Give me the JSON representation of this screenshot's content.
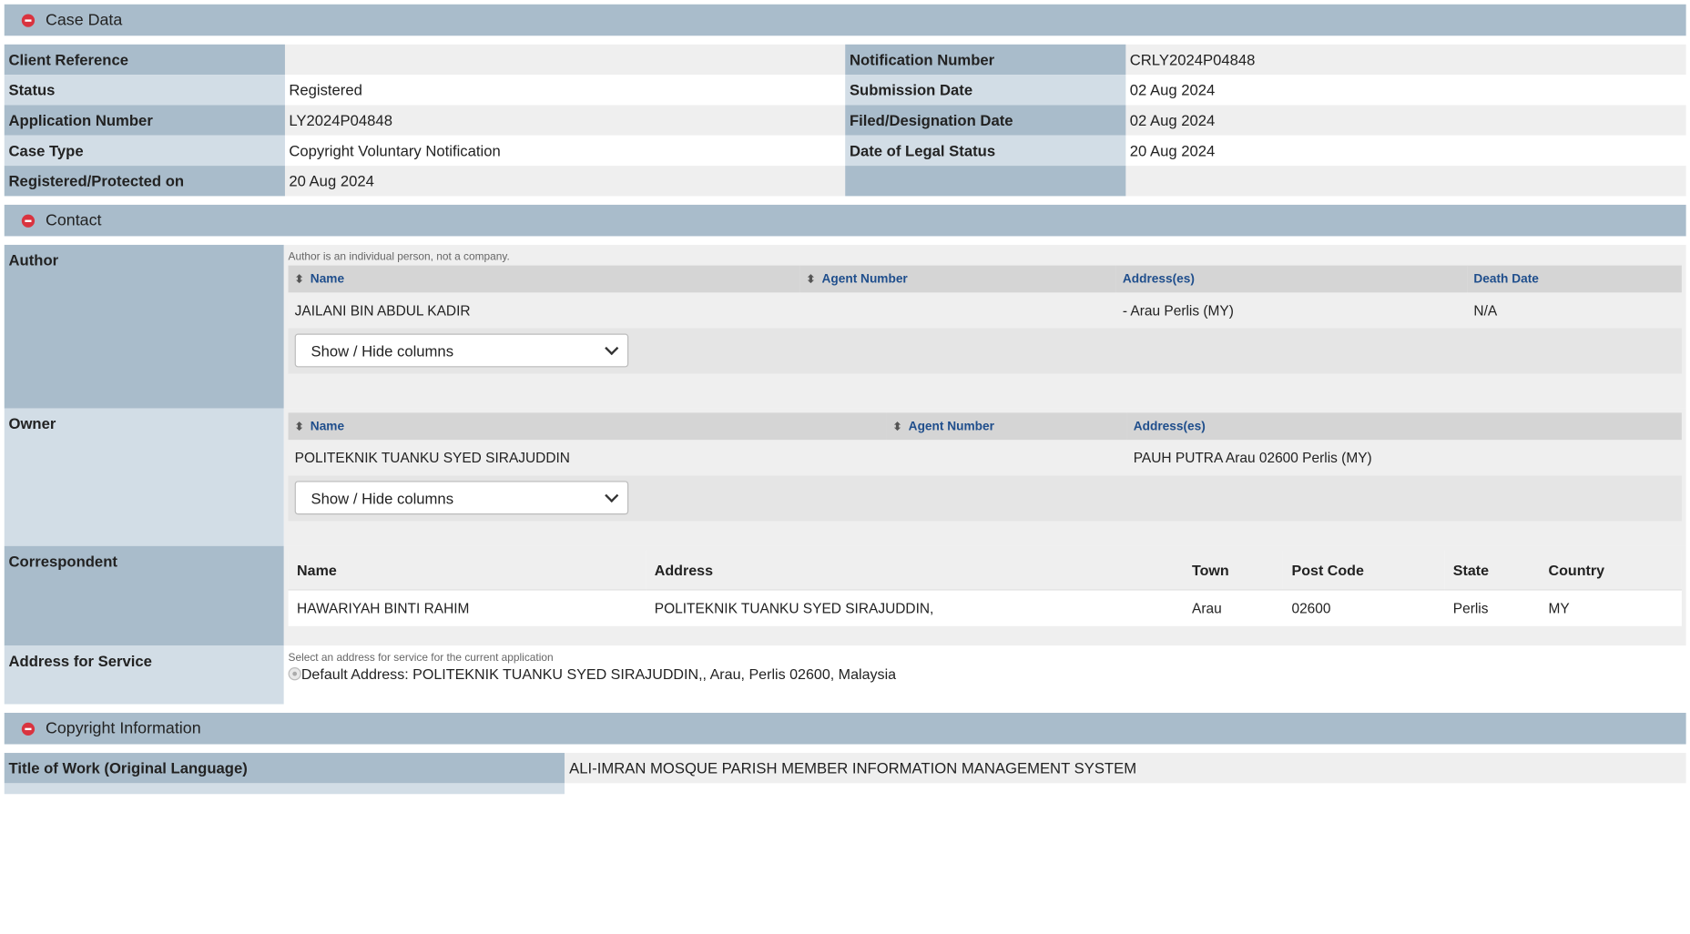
{
  "case_data": {
    "header": "Case Data",
    "rows": [
      {
        "l1": "Client Reference",
        "v1": "",
        "l2": "Notification Number",
        "v2": "CRLY2024P04848"
      },
      {
        "l1": "Status",
        "v1": "Registered",
        "l2": "Submission Date",
        "v2": "02 Aug 2024"
      },
      {
        "l1": "Application Number",
        "v1": "LY2024P04848",
        "l2": "Filed/Designation Date",
        "v2": "02 Aug 2024"
      },
      {
        "l1": "Case Type",
        "v1": "Copyright Voluntary Notification",
        "l2": "Date of Legal Status",
        "v2": "20 Aug 2024"
      },
      {
        "l1": "Registered/Protected on",
        "v1": "20 Aug 2024",
        "l2": "",
        "v2": ""
      }
    ]
  },
  "contact": {
    "header": "Contact",
    "author": {
      "label": "Author",
      "note": "Author is an individual person, not a company.",
      "columns": [
        "Name",
        "Agent Number",
        "Address(es)",
        "Death Date"
      ],
      "row": {
        "name": "JAILANI BIN ABDUL KADIR",
        "agent": "",
        "address": "- Arau Perlis (MY)",
        "death": "N/A"
      },
      "select_label": "Show / Hide columns"
    },
    "owner": {
      "label": "Owner",
      "columns": [
        "Name",
        "Agent Number",
        "Address(es)"
      ],
      "row": {
        "name": "POLITEKNIK TUANKU SYED SIRAJUDDIN",
        "agent": "",
        "address": "PAUH PUTRA Arau 02600 Perlis (MY)"
      },
      "select_label": "Show / Hide columns"
    },
    "correspondent": {
      "label": "Correspondent",
      "columns": [
        "Name",
        "Address",
        "Town",
        "Post Code",
        "State",
        "Country"
      ],
      "row": {
        "name": "HAWARIYAH BINTI RAHIM",
        "address": "POLITEKNIK TUANKU SYED SIRAJUDDIN,",
        "town": "Arau",
        "postcode": "02600",
        "state": "Perlis",
        "country": "MY"
      }
    },
    "service": {
      "label": "Address for Service",
      "note": "Select an address for service for the current application",
      "option": "Default Address: POLITEKNIK TUANKU SYED SIRAJUDDIN,, Arau, Perlis 02600, Malaysia"
    }
  },
  "copyright": {
    "header": "Copyright Information",
    "title_label": "Title of Work (Original Language)",
    "title_value": "ALI-IMRAN MOSQUE PARISH MEMBER INFORMATION MANAGEMENT SYSTEM"
  },
  "icons": {
    "collapse": "minus-circle-icon",
    "sort": "sort-icon",
    "dropdown": "chevron-down-icon"
  },
  "colors": {
    "header_bg": "#a9bccb",
    "label_dark": "#a9bccb",
    "label_light": "#d2dde6",
    "link_blue": "#1f4e8c",
    "collapse_red": "#d9333f"
  }
}
